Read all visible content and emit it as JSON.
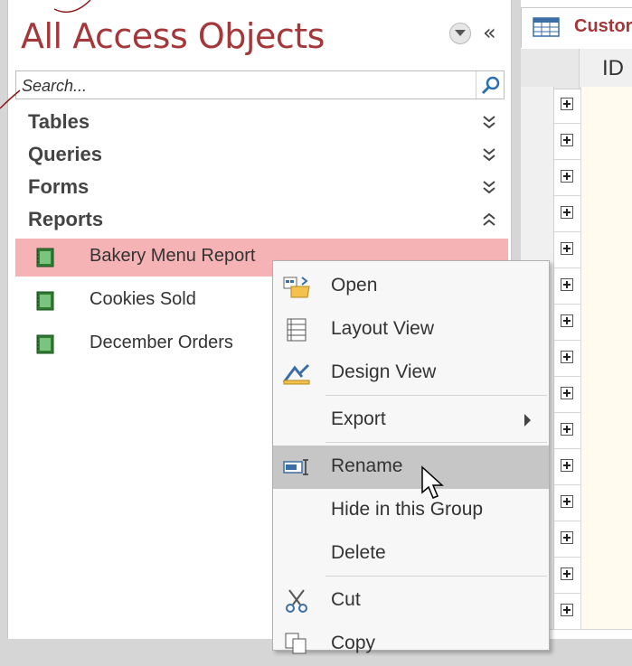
{
  "nav": {
    "title": "All Access Objects",
    "search_placeholder": "Search...",
    "groups": [
      {
        "label": "Tables",
        "expanded": false
      },
      {
        "label": "Queries",
        "expanded": false
      },
      {
        "label": "Forms",
        "expanded": false
      },
      {
        "label": "Reports",
        "expanded": true
      }
    ],
    "reports": [
      {
        "label": "Bakery Menu Report",
        "selected": true
      },
      {
        "label": "Cookies Sold",
        "selected": false
      },
      {
        "label": "December Orders",
        "selected": false
      }
    ]
  },
  "sheet": {
    "tab_label": "Custor",
    "column_header": "ID",
    "row_count": 15
  },
  "context_menu": {
    "items": [
      {
        "label": "Open",
        "icon": "open-icon"
      },
      {
        "label": "Layout View",
        "icon": "layout-view-icon"
      },
      {
        "label": "Design View",
        "icon": "design-view-icon"
      },
      {
        "label": "Export",
        "icon": "",
        "submenu": true
      },
      {
        "label": "Rename",
        "icon": "rename-icon",
        "highlighted": true
      },
      {
        "label": "Hide in this Group",
        "icon": ""
      },
      {
        "label": "Delete",
        "icon": ""
      },
      {
        "label": "Cut",
        "icon": "scissors-icon"
      },
      {
        "label": "Copy",
        "icon": "copy-icon"
      }
    ]
  },
  "colors": {
    "accent": "#a4373a",
    "selection": "#f5b3b5",
    "menu_hover": "#c6c6c6"
  }
}
